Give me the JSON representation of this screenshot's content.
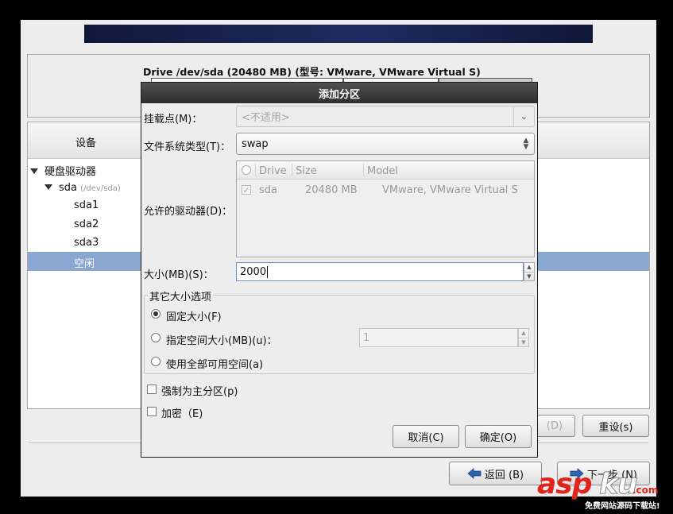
{
  "installer": {
    "drive_title": "Drive /dev/sda (20480 MB) (型号: VMware, VMware Virtual S)",
    "tree_header": "设备",
    "tree": {
      "group": "硬盘驱动器",
      "disk": "sda",
      "disk_path": "(/dev/sda)",
      "partitions": [
        "sda1",
        "sda2",
        "sda3"
      ],
      "free": "空闲"
    },
    "delete_button": "(D)",
    "reset_button": "重设(s)",
    "back_button": "返回 (B)",
    "next_button": "下一步 (N)"
  },
  "dialog": {
    "title": "添加分区",
    "mount_label": "挂载点(M)：",
    "mount_value": "<不适用>",
    "fstype_label": "文件系统类型(T)：",
    "fstype_value": "swap",
    "drives_label": "允许的驱动器(D)：",
    "drives_columns": [
      "Drive",
      "Size",
      "Model"
    ],
    "drives_rows": [
      {
        "checked": true,
        "drive": "sda",
        "size": "20480 MB",
        "model": "VMware, VMware Virtual S"
      }
    ],
    "size_label": "大小(MB)(S)：",
    "size_value": "2000",
    "options_title": "其它大小选项",
    "options": {
      "fixed": "固定大小(F)",
      "upto": "指定空间大小(MB)(u)：",
      "upto_value": "1",
      "fill": "使用全部可用空间(a)",
      "selected": "fixed"
    },
    "force_primary": "强制为主分区(p)",
    "encrypt": "加密（E)",
    "cancel_button": "取消(C)",
    "ok_button": "确定(O)"
  },
  "watermark": {
    "brand_asp": "asp",
    "brand_ku": "ku",
    "brand_suffix": ".com",
    "tagline": "免费网站源码下载站!"
  },
  "colors": {
    "selection": "#8aa7d1",
    "banner": "#1a2450",
    "dialog_title": "#3a3a3a",
    "watermark_red": "#e2231a"
  }
}
